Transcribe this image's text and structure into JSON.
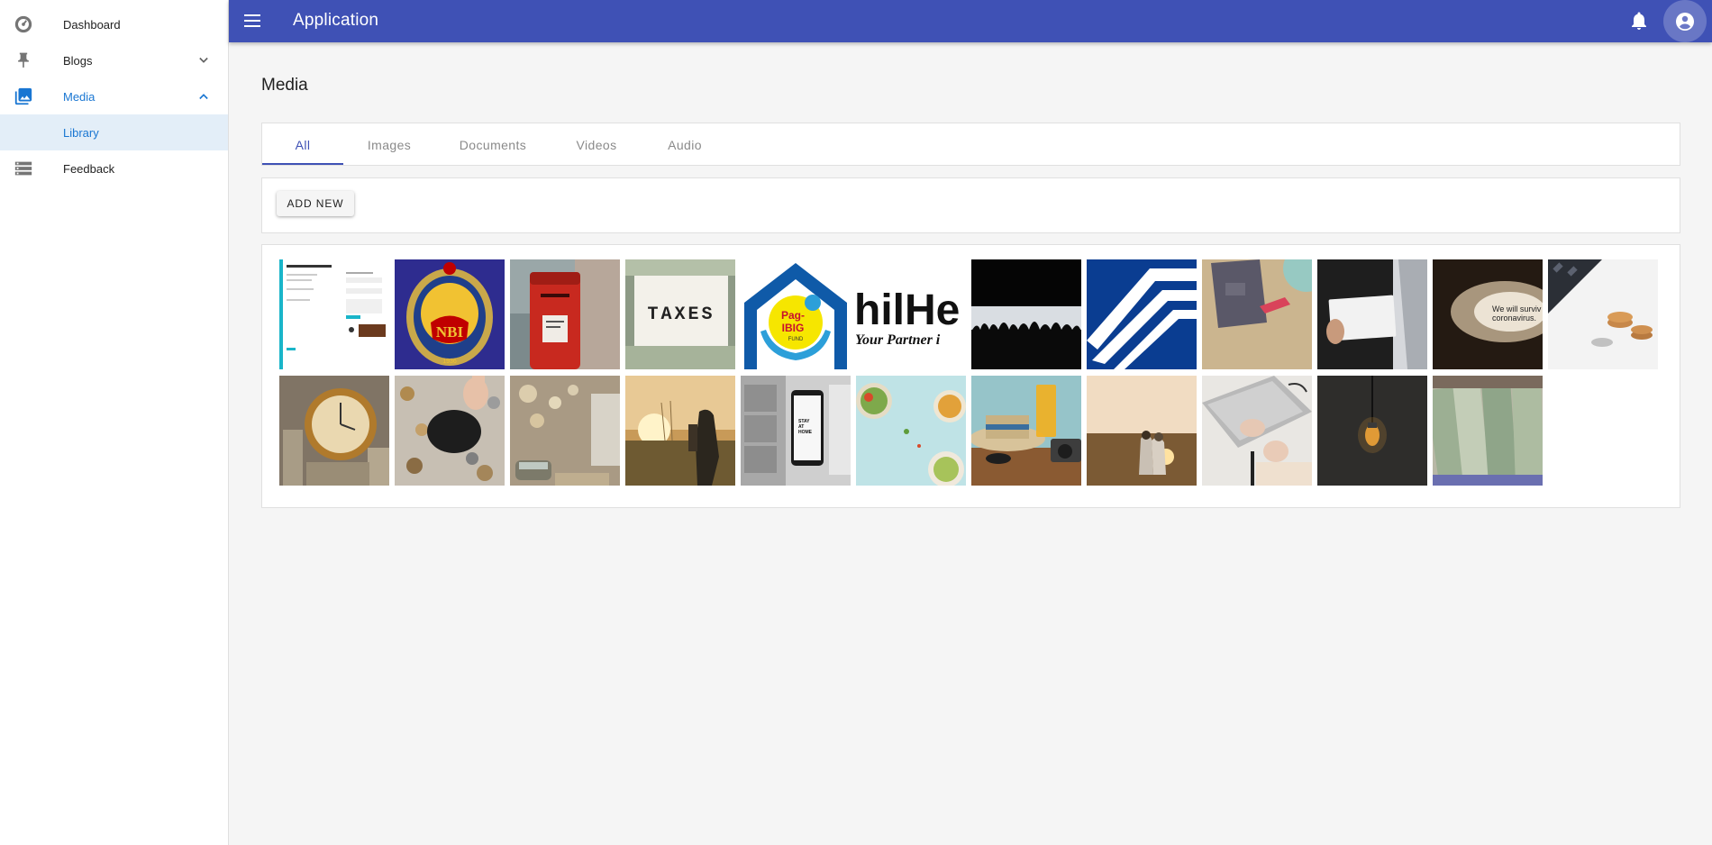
{
  "sidebar": {
    "items": [
      {
        "label": "Dashboard",
        "icon": "dashboard-icon"
      },
      {
        "label": "Blogs",
        "icon": "pin-icon",
        "expanded": false
      },
      {
        "label": "Media",
        "icon": "photo-library-icon",
        "expanded": true,
        "active": true
      },
      {
        "label": "Library",
        "sub": true,
        "selected": true
      },
      {
        "label": "Feedback",
        "icon": "storage-icon"
      }
    ]
  },
  "topbar": {
    "title": "Application",
    "menu_icon": "menu-icon",
    "notifications_icon": "bell-icon",
    "account_icon": "account-circle-icon",
    "color": "#3f51b5"
  },
  "main": {
    "title": "Media",
    "tabs": [
      {
        "label": "All",
        "active": true
      },
      {
        "label": "Images"
      },
      {
        "label": "Documents"
      },
      {
        "label": "Videos"
      },
      {
        "label": "Audio"
      }
    ],
    "add_button": "ADD NEW",
    "thumbnails": [
      {
        "name": "screenshot",
        "overlay_text": ""
      },
      {
        "name": "nbi-seal",
        "overlay_text": "NBI"
      },
      {
        "name": "mailbox",
        "overlay_text": ""
      },
      {
        "name": "taxes",
        "overlay_text": "TAXES"
      },
      {
        "name": "pagibig-logo",
        "overlay_text": "Pag-IBIG"
      },
      {
        "name": "philhealth-logo",
        "overlay_text": "hilHe"
      },
      {
        "name": "silhouettes",
        "overlay_text": ""
      },
      {
        "name": "sss-logo",
        "overlay_text": ""
      },
      {
        "name": "passport",
        "overlay_text": ""
      },
      {
        "name": "business-card",
        "overlay_text": ""
      },
      {
        "name": "we-will-survive",
        "overlay_text": "We will surviv coronavirus."
      },
      {
        "name": "calculator-coins",
        "overlay_text": ""
      },
      {
        "name": "coins-clock",
        "overlay_text": ""
      },
      {
        "name": "piggy-bank",
        "overlay_text": ""
      },
      {
        "name": "bokeh-van",
        "overlay_text": ""
      },
      {
        "name": "sunrise-hiker",
        "overlay_text": ""
      },
      {
        "name": "stay-at-home-phone",
        "overlay_text": "STAY AT HOME"
      },
      {
        "name": "food-bowls",
        "overlay_text": ""
      },
      {
        "name": "beach-drink",
        "overlay_text": ""
      },
      {
        "name": "couple-sunset",
        "overlay_text": ""
      },
      {
        "name": "laptop-hands",
        "overlay_text": ""
      },
      {
        "name": "light-bulb",
        "overlay_text": ""
      },
      {
        "name": "dollar-rolls",
        "overlay_text": ""
      }
    ]
  }
}
